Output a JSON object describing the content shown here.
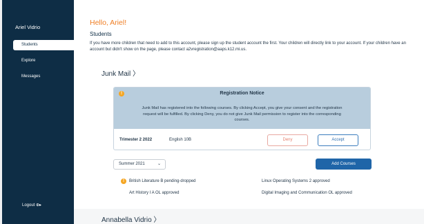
{
  "sidebar": {
    "user_name": "Ariel Vidrio",
    "items": [
      {
        "label": "Students"
      },
      {
        "label": "Explore"
      },
      {
        "label": "Messages"
      }
    ],
    "logout_label": "Logout ⊕▸"
  },
  "main": {
    "greeting": "Hello, Ariel!",
    "section_title": "Students",
    "info_text": "If you have more children that need to add to this account, please sign up the student account the first. Your children will directly link to your account. If your children have an account but didn't show on the page, please contact a2vregistration@aaps.k12.mi.us.",
    "children": [
      {
        "name": "Junk Mail 〉",
        "notice": {
          "icon": "!",
          "title": "Registration Notice",
          "body": "Junk Mail has registered into the following courses. By clicking Accept, you give your consent and the registration request will be fulfilled. By clicking Deny, you do not give Junk Mail permission to register into the corresponding courses.",
          "term": "Trimester 2 2022",
          "course": "English 10B",
          "deny_label": "Deny",
          "accept_label": "Accept"
        },
        "term_select": "Summer 2021",
        "add_courses_label": "Add Courses",
        "courses": [
          {
            "text": "British Literature B pending-dropped",
            "warning": "!"
          },
          {
            "text": "Linux Operating Systems 2 approved"
          },
          {
            "text": "Art History I A OL approved"
          },
          {
            "text": "Digital Imaging and Communication OL approved"
          }
        ]
      },
      {
        "name": "Annabella Vidrio 〉"
      }
    ]
  }
}
